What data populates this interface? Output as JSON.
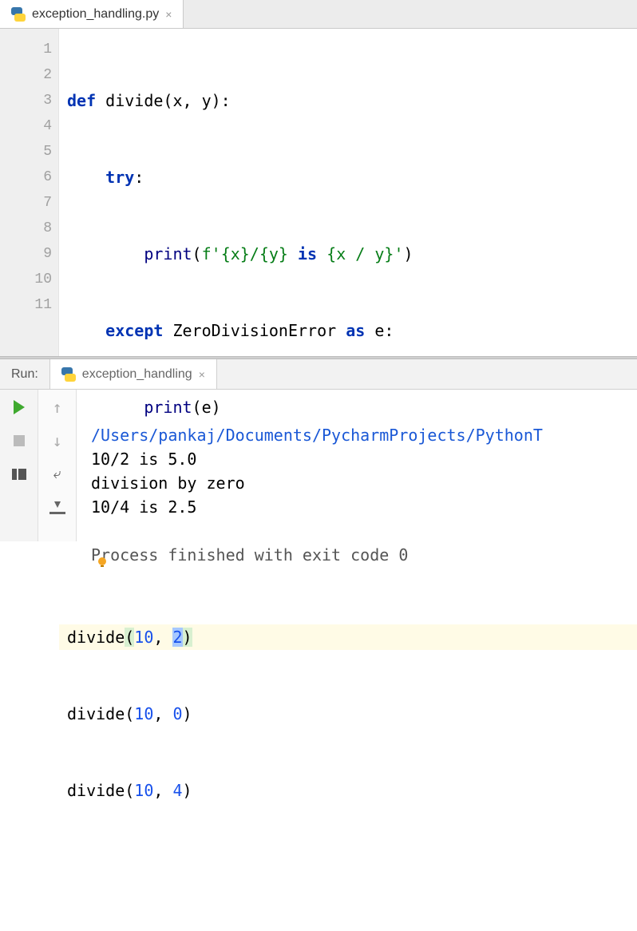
{
  "tab": {
    "filename": "exception_handling.py",
    "icon": "python-file-icon"
  },
  "editor": {
    "line_numbers": [
      "1",
      "2",
      "3",
      "4",
      "5",
      "6",
      "7",
      "8",
      "9",
      "10",
      "11"
    ],
    "highlighted_line_index": 7,
    "intention_bulb_line_index": 6,
    "code": {
      "l1": {
        "indent": "",
        "def": "def",
        "fname": "divide",
        "sig": "(x, y):"
      },
      "l2": {
        "indent": "    ",
        "try": "try",
        "colon": ":"
      },
      "l3": {
        "indent": "        ",
        "print": "print",
        "open": "(",
        "fstr_prefix": "f",
        "q1": "'",
        "lit1": "{x}/{y} ",
        "is": "is",
        "lit2": " {x / y}",
        "q2": "'",
        "close": ")"
      },
      "l4": {
        "indent": "    ",
        "except": "except",
        "err": "ZeroDivisionError",
        "as": "as",
        "var": "e",
        "colon": ":"
      },
      "l5": {
        "indent": "        ",
        "print": "print",
        "open": "(",
        "arg": "e",
        "close": ")"
      },
      "l6": "",
      "l7": "",
      "l8": {
        "call": "divide",
        "open": "(",
        "a": "10",
        "comma": ", ",
        "b": "2",
        "close": ")"
      },
      "l9": {
        "call": "divide",
        "open": "(",
        "a": "10",
        "comma": ", ",
        "b": "0",
        "close": ")"
      },
      "l10": {
        "call": "divide",
        "open": "(",
        "a": "10",
        "comma": ", ",
        "b": "4",
        "close": ")"
      },
      "l11": ""
    }
  },
  "run": {
    "label": "Run:",
    "config_name": "exception_handling",
    "console": {
      "path": "/Users/pankaj/Documents/PycharmProjects/PythonT",
      "out1": "10/2 is 5.0",
      "out2": "division by zero",
      "out3": "10/4 is 2.5",
      "exit": "Process finished with exit code 0"
    }
  }
}
